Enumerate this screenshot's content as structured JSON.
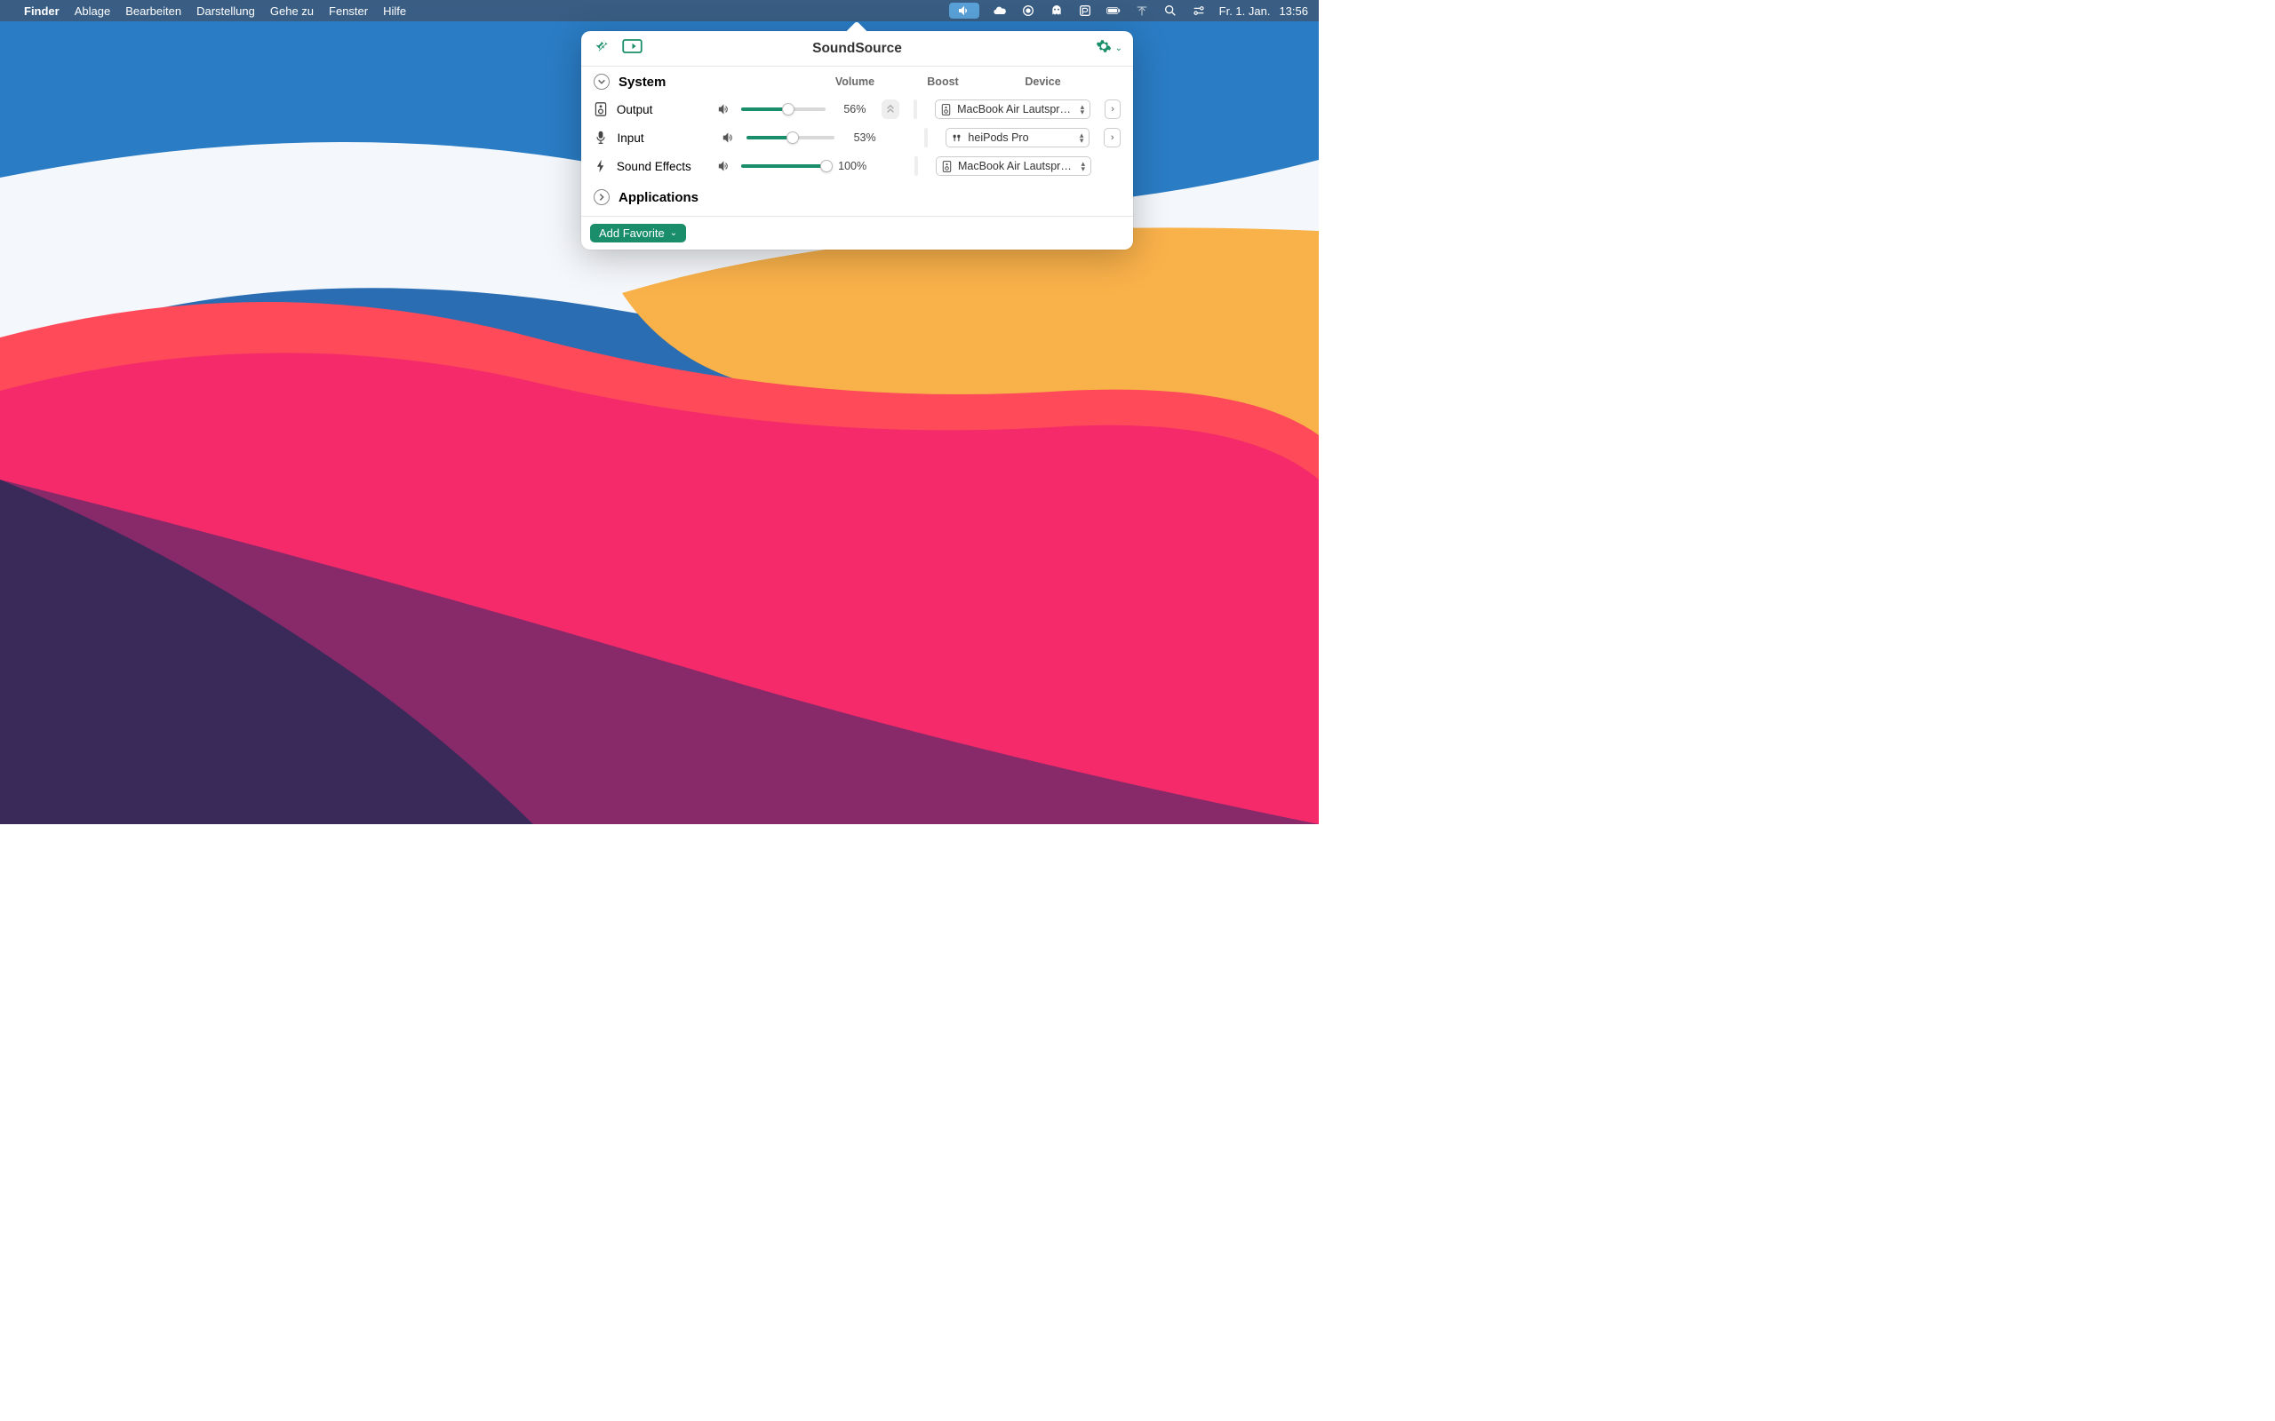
{
  "menubar": {
    "app": "Finder",
    "menus": [
      "Ablage",
      "Bearbeiten",
      "Darstellung",
      "Gehe zu",
      "Fenster",
      "Hilfe"
    ],
    "date": "Fr. 1. Jan.",
    "time": "13:56"
  },
  "popover": {
    "title": "SoundSource",
    "sections": {
      "system": {
        "label": "System",
        "columns": {
          "volume": "Volume",
          "boost": "Boost",
          "device": "Device"
        },
        "rows": [
          {
            "id": "output",
            "label": "Output",
            "volume": 56,
            "volume_label": "56%",
            "has_boost": true,
            "device": "MacBook Air Lautsprec…",
            "device_icon": "speaker",
            "has_expand": true
          },
          {
            "id": "input",
            "label": "Input",
            "volume": 53,
            "volume_label": "53%",
            "has_boost": false,
            "device": "heiPods Pro",
            "device_icon": "airpods",
            "has_expand": true
          },
          {
            "id": "effects",
            "label": "Sound Effects",
            "volume": 100,
            "volume_label": "100%",
            "has_boost": false,
            "device": "MacBook Air Lautsprec…",
            "device_icon": "speaker",
            "has_expand": false
          }
        ]
      },
      "applications": {
        "label": "Applications"
      }
    },
    "footer": {
      "add_favorite": "Add Favorite"
    }
  }
}
